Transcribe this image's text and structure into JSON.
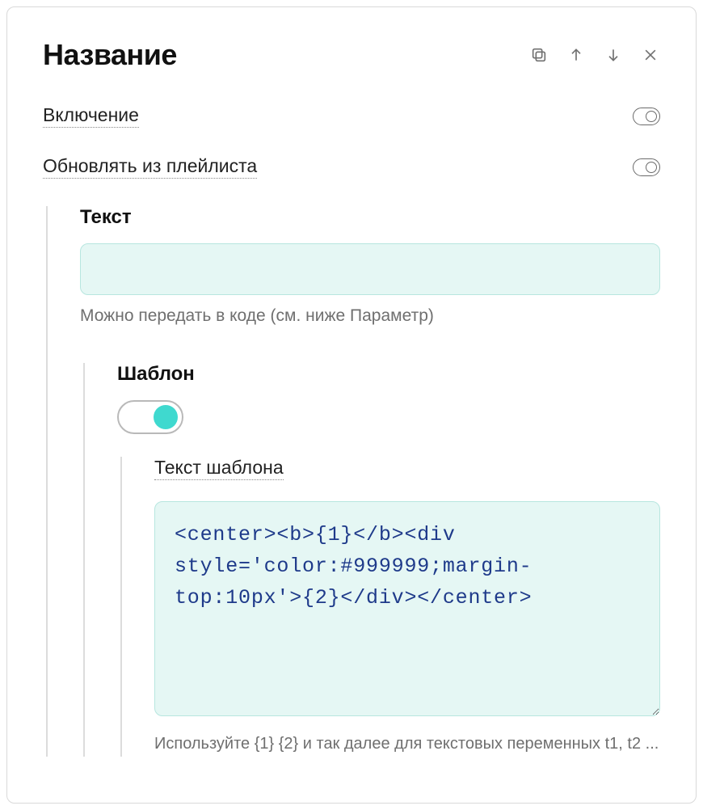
{
  "header": {
    "title": "Название"
  },
  "toggles": {
    "enable_label": "Включение",
    "enable_value": false,
    "update_label": "Обновлять из плейлиста",
    "update_value": false
  },
  "text_section": {
    "heading": "Текст",
    "value": "",
    "hint": "Можно передать в коде (см. ниже Параметр)"
  },
  "template_section": {
    "heading": "Шаблон",
    "enabled": true,
    "text_heading": "Текст шаблона",
    "code": "<center><b>{1}</b><div style='color:#999999;margin-top:10px'>{2}</div></center>",
    "hint": "Используйте {1} {2} и так далее для текстовых переменных t1, t2 ..."
  },
  "icons": {
    "copy": "copy",
    "up": "up",
    "down": "down",
    "close": "close"
  }
}
